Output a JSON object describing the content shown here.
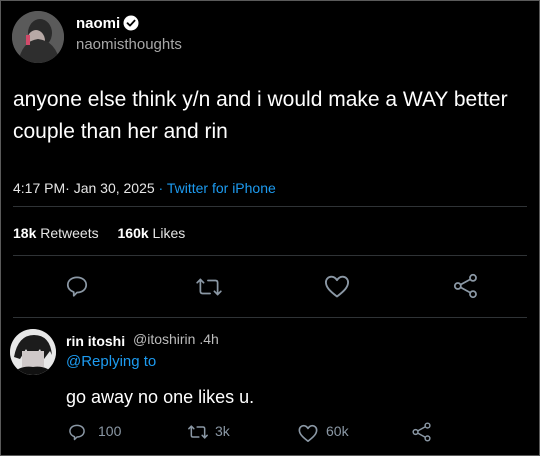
{
  "tweet": {
    "author_name": "naomi",
    "author_handle": "naomisthoughts",
    "text": "anyone else think y/n and i would make a WAY better couple than her and rin",
    "time": "4:17 PM",
    "date": "· Jan 30, 2025",
    "source": "· Twitter for iPhone",
    "retweets_count": "18k",
    "retweets_label": "Retweets",
    "likes_count": "160k",
    "likes_label": "Likes"
  },
  "reply": {
    "author_name": "rin itoshi",
    "author_handle": "@itoshirin .4h",
    "replying_to": "@Replying to",
    "text": "go away no one likes u.",
    "reply_count": "100",
    "retweet_count": "3k",
    "like_count": "60k"
  },
  "icons": {
    "reply": "comment-icon",
    "retweet": "retweet-icon",
    "like": "heart-icon",
    "share": "share-icon",
    "verified": "verified-badge-icon"
  },
  "colors": {
    "background": "#000000",
    "link": "#1d9bf0",
    "muted": "#8b98a5"
  }
}
